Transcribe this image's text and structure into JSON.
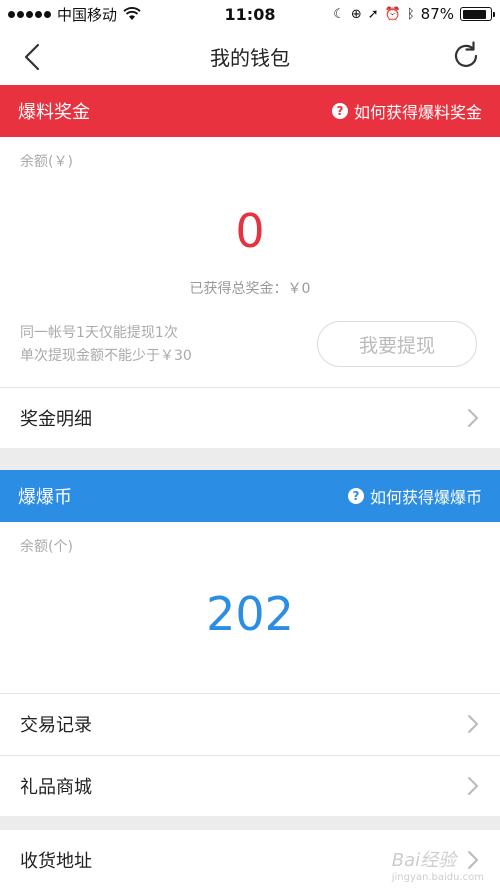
{
  "status_bar": {
    "carrier": "中国移动",
    "time": "11:08",
    "battery": "87%",
    "battery_level": 0.87
  },
  "nav": {
    "title": "我的钱包"
  },
  "bonus_section": {
    "title": "爆料奖金",
    "help_text": "如何获得爆料奖金",
    "color": "#e8323f",
    "balance_label": "余额(￥)",
    "balance_value": "0",
    "total_earned": "已获得总奖金：￥0",
    "note_line1": "同一帐号1天仅能提现1次",
    "note_line2": "单次提现金额不能少于￥30",
    "withdraw_label": "我要提现",
    "detail_label": "奖金明细"
  },
  "coin_section": {
    "title": "爆爆币",
    "help_text": "如何获得爆爆币",
    "color": "#2b8de3",
    "balance_label": "余额(个)",
    "balance_value": "202"
  },
  "menu": {
    "transactions": "交易记录",
    "gift_mall": "礼品商城",
    "address": "收货地址"
  },
  "watermark": {
    "text": "Bai经验",
    "sub": "jingyan.baidu.com"
  }
}
